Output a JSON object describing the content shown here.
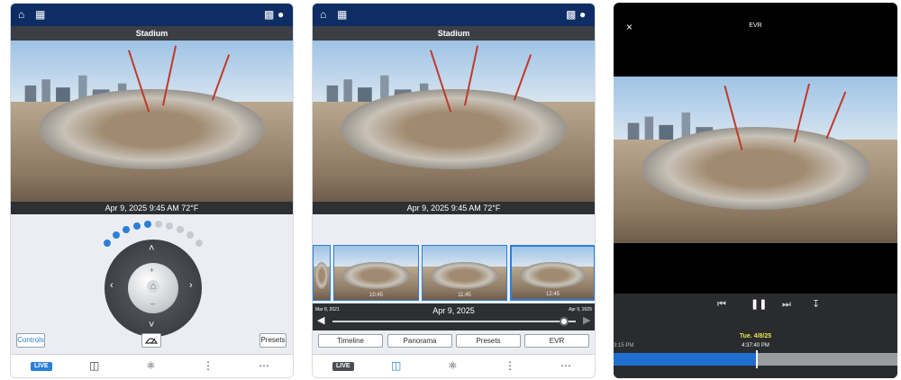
{
  "screens": [
    {
      "camera_title": "Stadium",
      "timestamp": "Apr 9, 2025  9:45 AM 72°F",
      "controls_label": "Controls",
      "presets_label": "Presets",
      "live_badge": "LIVE",
      "ptz_up": "˄",
      "ptz_down": "˅",
      "ptz_left": "‹",
      "ptz_right": "›",
      "zoom_in": "+",
      "zoom_out": "–",
      "home_glyph": "⌂",
      "slider_progress": 0.45
    },
    {
      "camera_title": "Stadium",
      "timestamp": "Apr 9, 2025  9:45 AM 72°F",
      "timeline_date": "Apr 9, 2025",
      "timeline_start": "Mar 8, 2021",
      "timeline_end": "Apr 9, 2025",
      "timeline_position": 0.95,
      "thumbnail_labels": [
        "",
        "10:45",
        "11:45",
        "12:45"
      ],
      "tabs": [
        "Timeline",
        "Panorama",
        "Presets",
        "EVR"
      ],
      "live_badge": "LIVE"
    },
    {
      "title": "EVR",
      "close_glyph": "×",
      "date_label": "Tue. 4/8/25",
      "time_label": "4:37:40 PM",
      "left_time": "3:15 PM",
      "playback_progress": 0.5
    }
  ],
  "colors": {
    "nav_bg": "#0d2d64",
    "accent": "#2b7fd8",
    "live_red": "#d93025",
    "live_gray": "#4a4d52",
    "evr_date": "#e9e34a",
    "evr_bar": "#1f6fd0"
  }
}
